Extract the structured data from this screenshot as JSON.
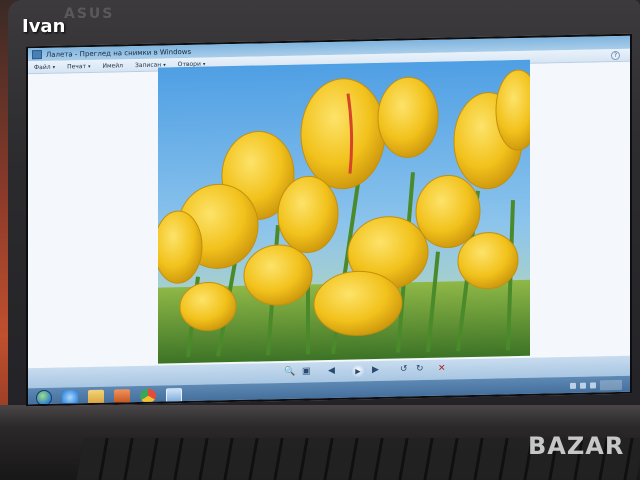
{
  "photo_labels": {
    "username": "Ivan",
    "watermark": "BAZAR",
    "laptop_brand": "ASUS"
  },
  "window": {
    "title": "Лалета - Преглед на снимки в Windows"
  },
  "menu": {
    "items": [
      {
        "label": "Файл",
        "caret": "▾"
      },
      {
        "label": "Печат",
        "caret": "▾"
      },
      {
        "label": "Имейл",
        "caret": ""
      },
      {
        "label": "Записан",
        "caret": "▾"
      },
      {
        "label": "Отвори",
        "caret": "▾"
      }
    ],
    "help": "?"
  },
  "viewer": {
    "image_subject": "yellow tulips against blue sky",
    "colors": {
      "petal": "#f2c21c",
      "sky": "#5aa7e6",
      "stem": "#4d8a32"
    }
  },
  "controls": {
    "zoom_icon": "🔍",
    "fit_icon": "▣",
    "prev_icon": "◀",
    "play_icon": "▶",
    "next_icon": "▶",
    "rotate_left_icon": "↺",
    "rotate_right_icon": "↻",
    "delete_icon": "✕"
  },
  "taskbar": {
    "pinned": [
      "internet-explorer",
      "file-explorer",
      "media-player",
      "chrome",
      "photo-viewer"
    ]
  }
}
